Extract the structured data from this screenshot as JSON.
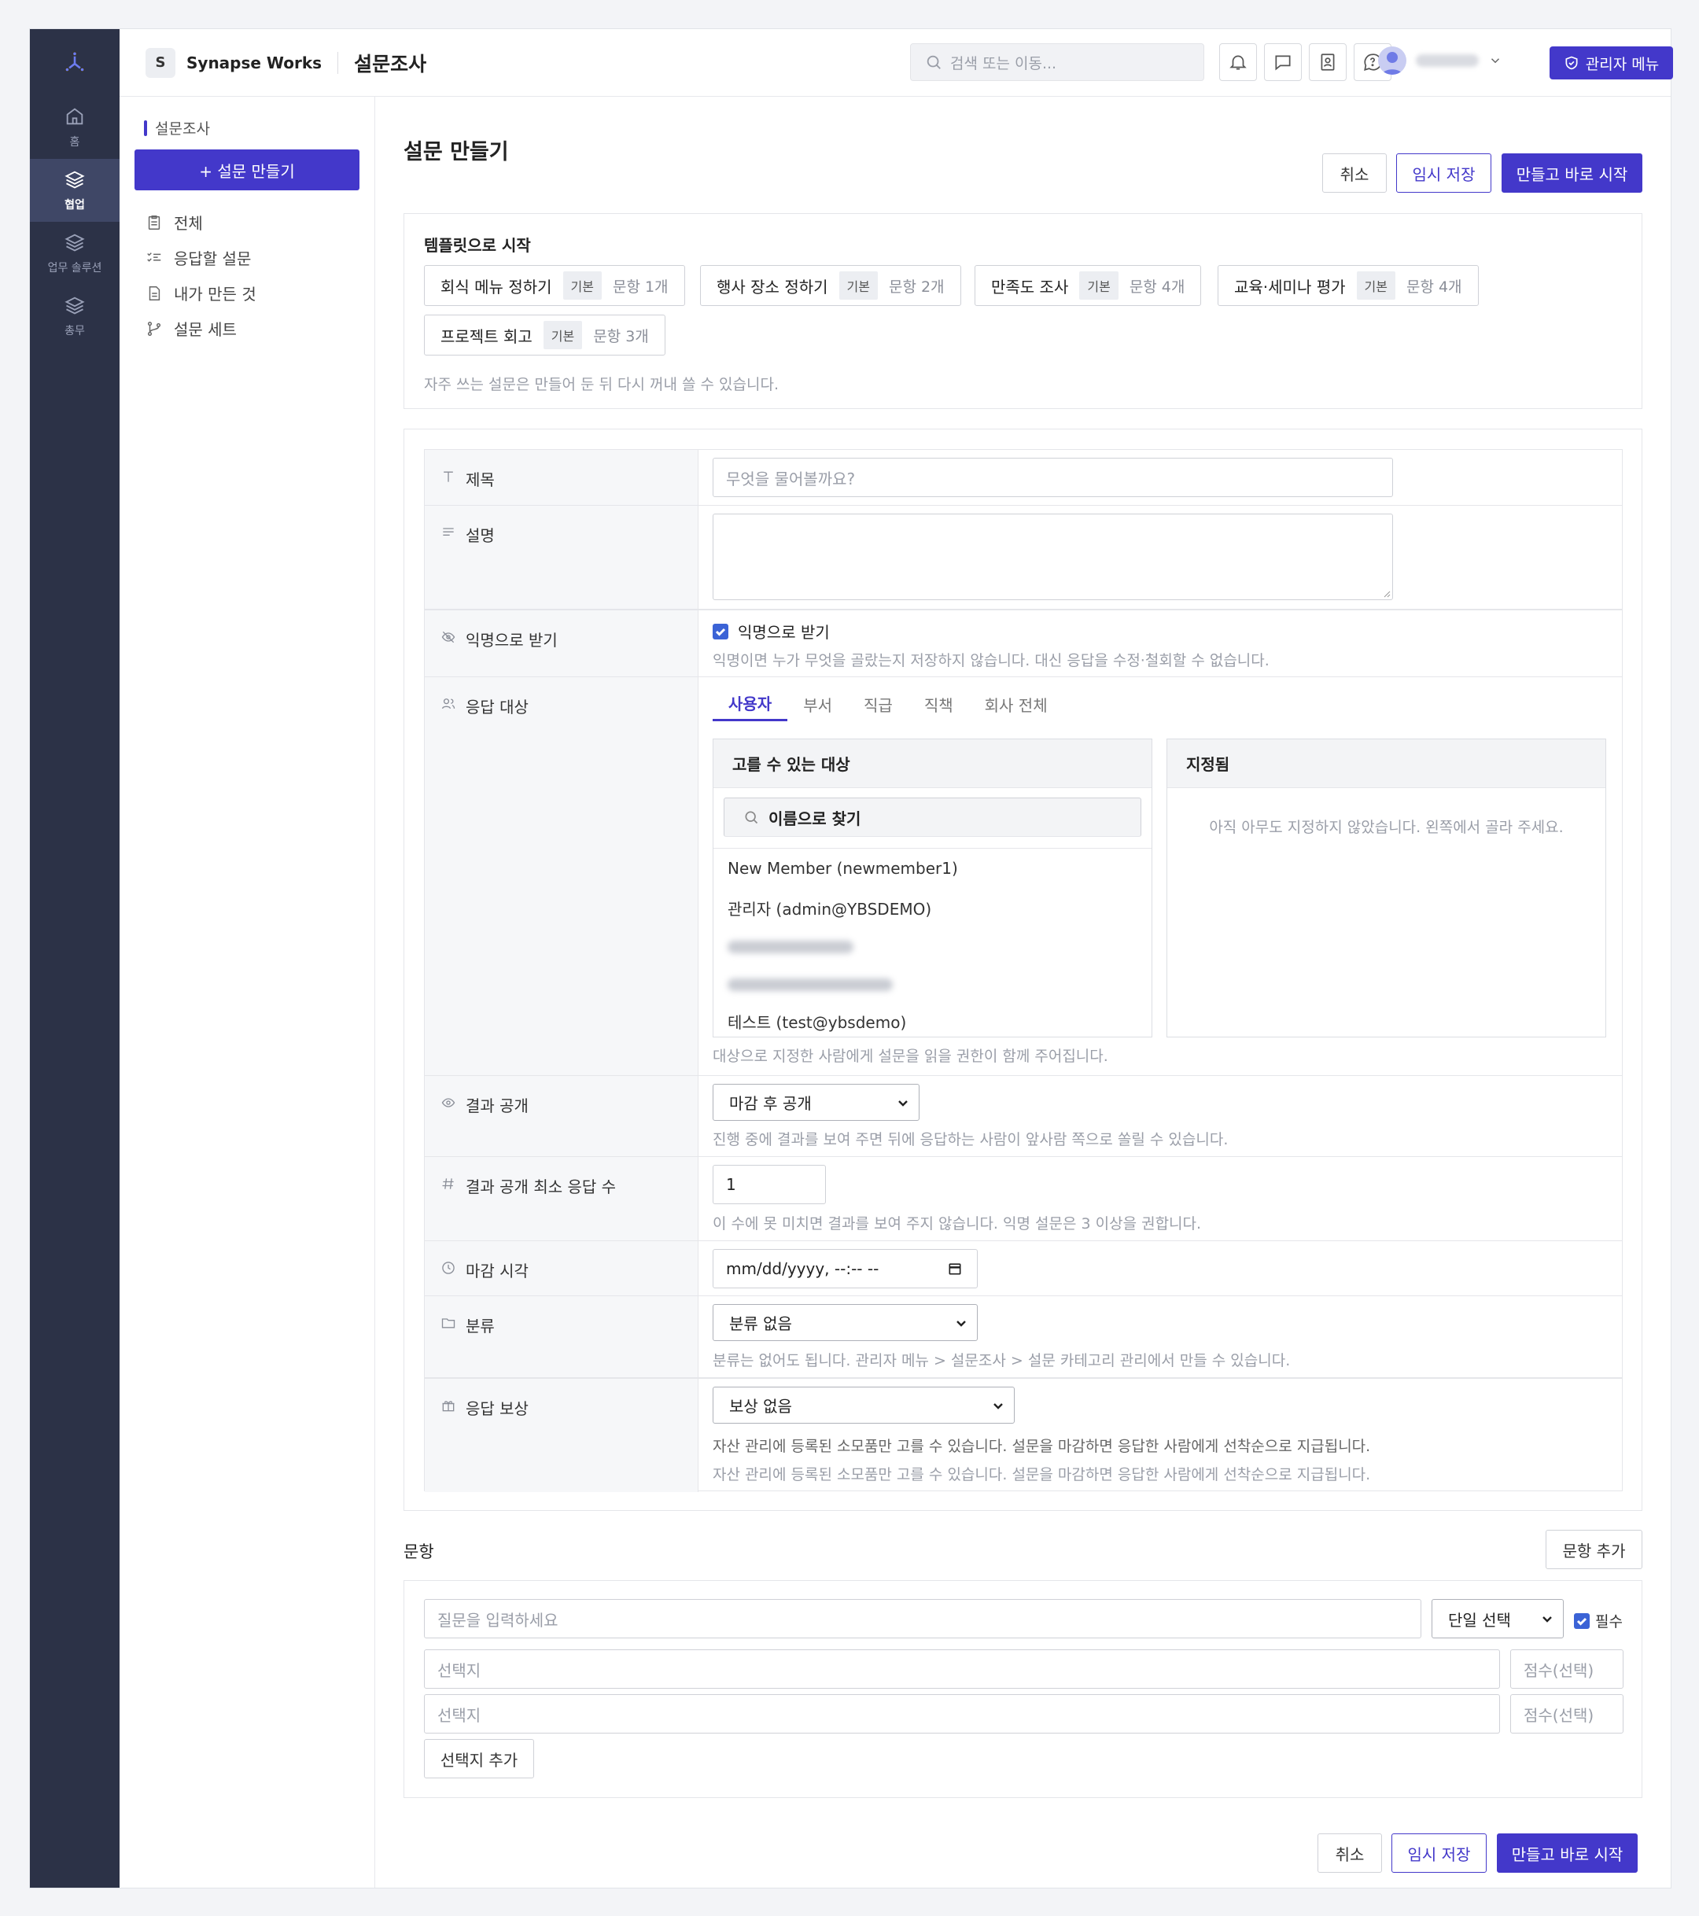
{
  "rail": {
    "items": [
      {
        "label": "홈"
      },
      {
        "label": "협업"
      },
      {
        "label": "업무 솔루션"
      },
      {
        "label": "총무"
      }
    ]
  },
  "topbar": {
    "workspace_initial": "S",
    "workspace_name": "Synapse Works",
    "page_title": "설문조사",
    "search_placeholder": "검색 또는 이동...",
    "admin_label": "관리자 메뉴"
  },
  "sidebar": {
    "section": "설문조사",
    "new_button": "+ 설문 만들기",
    "items": [
      {
        "label": "전체"
      },
      {
        "label": "응답할 설문"
      },
      {
        "label": "내가 만든 것"
      },
      {
        "label": "설문 세트"
      }
    ]
  },
  "main": {
    "title": "설문 만들기",
    "cancel": "취소",
    "save_draft": "임시 저장",
    "create_start": "만들고 바로 시작",
    "templates": {
      "title": "템플릿으로 시작",
      "items": [
        {
          "name": "회식 메뉴 정하기",
          "tag": "기본",
          "count": "문항 1개"
        },
        {
          "name": "행사 장소 정하기",
          "tag": "기본",
          "count": "문항 2개"
        },
        {
          "name": "만족도 조사",
          "tag": "기본",
          "count": "문항 4개"
        },
        {
          "name": "교육·세미나 평가",
          "tag": "기본",
          "count": "문항 4개"
        },
        {
          "name": "프로젝트 회고",
          "tag": "기본",
          "count": "문항 3개"
        }
      ],
      "hint": "자주 쓰는 설문은 만들어 둔 뒤 다시 꺼내 쓸 수 있습니다."
    },
    "form": {
      "title_label": "제목",
      "title_placeholder": "무엇을 물어볼까요?",
      "desc_label": "설명",
      "anon_label": "익명으로 받기",
      "anon_check": "익명으로 받기",
      "anon_checked": true,
      "anon_hint": "익명이면 누가 무엇을 골랐는지 저장하지 않습니다. 대신 응답을 수정·철회할 수 없습니다.",
      "target_label": "응답 대상",
      "target_tabs": [
        "사용자",
        "부서",
        "직급",
        "직책",
        "회사 전체"
      ],
      "available_title": "고를 수 있는 대상",
      "search_placeholder": "이름으로 찾기",
      "people": [
        "New Member (newmember1)",
        "관리자 (admin@YBSDEMO)",
        "테스트 (test@ybsdemo)"
      ],
      "assigned_title": "지정됨",
      "assigned_empty": "아직 아무도 지정하지 않았습니다. 왼쪽에서 골라 주세요.",
      "target_hint": "대상으로 지정한 사람에게 설문을 읽을 권한이 함께 주어집니다.",
      "result_label": "결과 공개",
      "result_value": "마감 후 공개",
      "result_hint": "진행 중에 결과를 보여 주면 뒤에 응답하는 사람이 앞사람 쪽으로 쏠릴 수 있습니다.",
      "min_label": "결과 공개 최소 응답 수",
      "min_value": "1",
      "min_hint": "이 수에 못 미치면 결과를 보여 주지 않습니다. 익명 설문은 3 이상을 권합니다.",
      "deadline_label": "마감 시각",
      "deadline_value": "mm/dd/yyyy, --:-- --",
      "category_label": "분류",
      "category_value": "분류 없음",
      "category_hint": "분류는 없어도 됩니다. 관리자 메뉴 > 설문조사 > 설문 카테고리 관리에서 만들 수 있습니다.",
      "reward_label": "응답 보상",
      "reward_value": "보상 없음",
      "reward_hint": "자산 관리에 등록된 소모품만 고를 수 있습니다. 설문을 마감하면 응답한 사람에게 선착순으로 지급됩니다."
    },
    "questions": {
      "title": "문항",
      "add_question": "문항 추가",
      "question_placeholder": "질문을 입력하세요",
      "type_value": "단일 선택",
      "required_label": "필수",
      "required_checked": true,
      "option_placeholder": "선택지",
      "score_placeholder": "점수(선택)",
      "add_option": "선택지 추가"
    }
  }
}
